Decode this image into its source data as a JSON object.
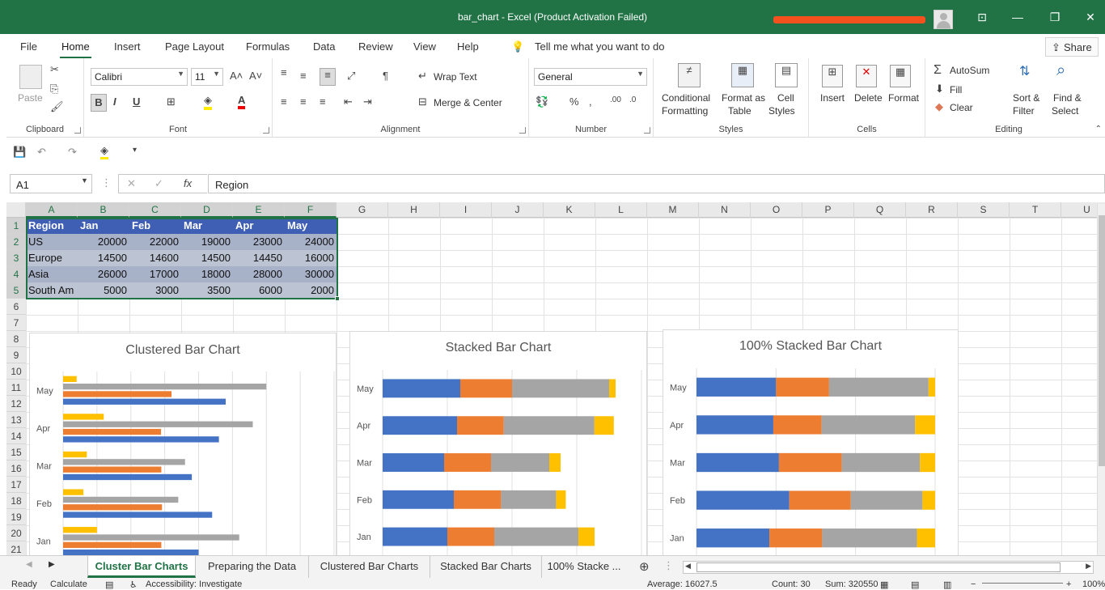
{
  "window": {
    "title": "bar_chart  -  Excel (Product Activation Failed)"
  },
  "menu": [
    "File",
    "Home",
    "Insert",
    "Page Layout",
    "Formulas",
    "Data",
    "Review",
    "View",
    "Help"
  ],
  "tell_me": "Tell me what you want to do",
  "share": "Share",
  "ribbon": {
    "clipboard": {
      "paste": "Paste",
      "label": "Clipboard"
    },
    "font": {
      "name": "Calibri",
      "size": "11",
      "bold": "B",
      "italic": "I",
      "underline": "U",
      "label": "Font"
    },
    "alignment": {
      "wrap": "Wrap Text",
      "merge": "Merge & Center",
      "label": "Alignment"
    },
    "number": {
      "format": "General",
      "label": "Number"
    },
    "styles": {
      "conditional": "Conditional",
      "conditional2": "Formatting",
      "format_as": "Format as",
      "format_as2": "Table",
      "cell": "Cell",
      "cell2": "Styles",
      "label": "Styles"
    },
    "cells": {
      "insert": "Insert",
      "delete": "Delete",
      "format": "Format",
      "label": "Cells"
    },
    "editing": {
      "autosum": "AutoSum",
      "fill": "Fill",
      "clear": "Clear",
      "sort": "Sort &",
      "sort2": "Filter",
      "find": "Find &",
      "find2": "Select",
      "label": "Editing"
    }
  },
  "formula_bar": {
    "name_box": "A1",
    "value": "Region"
  },
  "columns": [
    "A",
    "B",
    "C",
    "D",
    "E",
    "F",
    "G",
    "H",
    "I",
    "J",
    "K",
    "L",
    "M",
    "N",
    "O",
    "P",
    "Q",
    "R",
    "S",
    "T",
    "U"
  ],
  "rows": [
    "1",
    "2",
    "3",
    "4",
    "5",
    "6",
    "7",
    "8",
    "9",
    "10",
    "11",
    "12",
    "13",
    "14",
    "15",
    "16",
    "17",
    "18",
    "19",
    "20",
    "21"
  ],
  "table": {
    "headers": [
      "Region",
      "Jan",
      "Feb",
      "Mar",
      "Apr",
      "May"
    ],
    "rows": [
      [
        "US",
        "20000",
        "22000",
        "19000",
        "23000",
        "24000"
      ],
      [
        "Europe",
        "14500",
        "14600",
        "14500",
        "14450",
        "16000"
      ],
      [
        "Asia",
        "26000",
        "17000",
        "18000",
        "28000",
        "30000"
      ],
      [
        "South Am",
        "5000",
        "3000",
        "3500",
        "6000",
        "2000"
      ]
    ]
  },
  "colors": {
    "US": "#4472C4",
    "Europe": "#ED7D31",
    "Asia": "#A5A5A5",
    "South Am": "#FFC000",
    "excel_green": "#217346"
  },
  "chart_data": [
    {
      "type": "bar",
      "title": "Clustered Bar Chart",
      "categories": [
        "Jan",
        "Feb",
        "Mar",
        "Apr",
        "May"
      ],
      "series": [
        {
          "name": "US",
          "values": [
            20000,
            22000,
            19000,
            23000,
            24000
          ]
        },
        {
          "name": "Europe",
          "values": [
            14500,
            14600,
            14500,
            14450,
            16000
          ]
        },
        {
          "name": "Asia",
          "values": [
            26000,
            17000,
            18000,
            28000,
            30000
          ]
        },
        {
          "name": "South Am",
          "values": [
            5000,
            3000,
            3500,
            6000,
            2000
          ]
        }
      ]
    },
    {
      "type": "bar",
      "title": "Stacked Bar Chart",
      "stacked": true,
      "categories": [
        "Jan",
        "Feb",
        "Mar",
        "Apr",
        "May"
      ],
      "series": [
        {
          "name": "US",
          "values": [
            20000,
            22000,
            19000,
            23000,
            24000
          ]
        },
        {
          "name": "Europe",
          "values": [
            14500,
            14600,
            14500,
            14450,
            16000
          ]
        },
        {
          "name": "Asia",
          "values": [
            26000,
            17000,
            18000,
            28000,
            30000
          ]
        },
        {
          "name": "South Am",
          "values": [
            5000,
            3000,
            3500,
            6000,
            2000
          ]
        }
      ]
    },
    {
      "type": "bar",
      "title": "100% Stacked Bar Chart",
      "stacked": "percent",
      "categories": [
        "Jan",
        "Feb",
        "Mar",
        "Apr",
        "May"
      ],
      "series": [
        {
          "name": "US",
          "values": [
            20000,
            22000,
            19000,
            23000,
            24000
          ]
        },
        {
          "name": "Europe",
          "values": [
            14500,
            14600,
            14500,
            14450,
            16000
          ]
        },
        {
          "name": "Asia",
          "values": [
            26000,
            17000,
            18000,
            28000,
            30000
          ]
        },
        {
          "name": "South Am",
          "values": [
            5000,
            3000,
            3500,
            6000,
            2000
          ]
        }
      ]
    }
  ],
  "tabs": [
    "Cluster Bar Charts",
    "Preparing the Data",
    "Clustered Bar Charts",
    "Stacked Bar Charts",
    "100% Stacke ..."
  ],
  "status": {
    "ready": "Ready",
    "calculate": "Calculate",
    "accessibility": "Accessibility: Investigate",
    "average": "Average: 16027.5",
    "count": "Count: 30",
    "sum": "Sum: 320550",
    "zoom": "100%"
  }
}
